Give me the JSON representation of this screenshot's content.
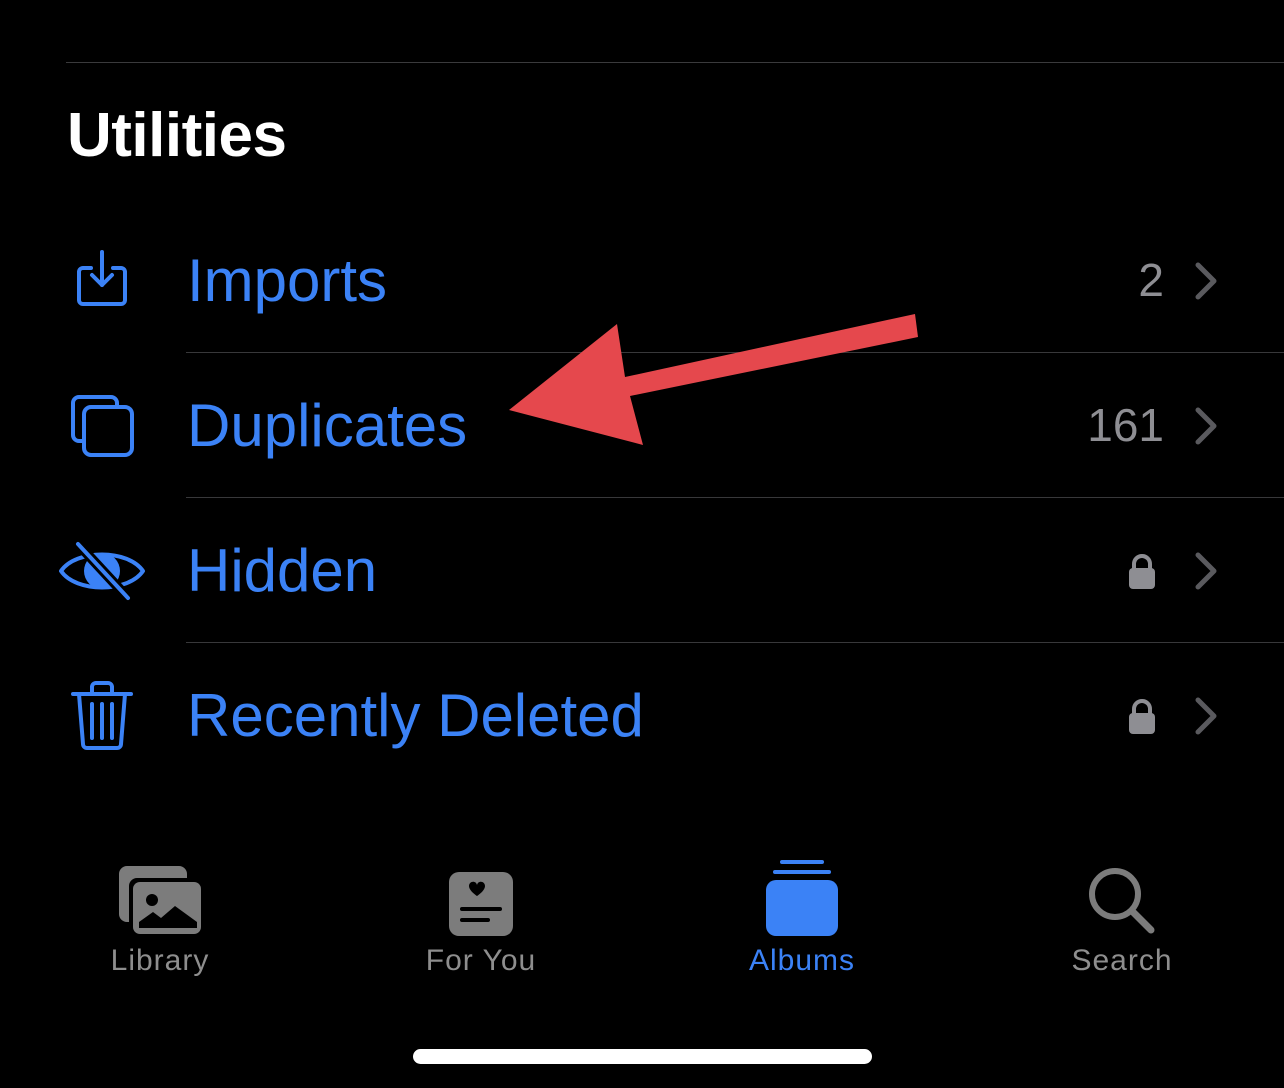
{
  "section": {
    "title": "Utilities"
  },
  "rows": [
    {
      "label": "Imports",
      "value": "2",
      "locked": false,
      "icon": "import-tray-icon"
    },
    {
      "label": "Duplicates",
      "value": "161",
      "locked": false,
      "icon": "duplicate-squares-icon"
    },
    {
      "label": "Hidden",
      "value": "",
      "locked": true,
      "icon": "eye-slash-icon"
    },
    {
      "label": "Recently Deleted",
      "value": "",
      "locked": true,
      "icon": "trash-icon"
    }
  ],
  "tabbar": {
    "tabs": [
      {
        "label": "Library",
        "icon": "photo-stack-icon",
        "active": false
      },
      {
        "label": "For You",
        "icon": "heart-card-icon",
        "active": false
      },
      {
        "label": "Albums",
        "icon": "albums-stack-icon",
        "active": true
      },
      {
        "label": "Search",
        "icon": "search-icon",
        "active": false
      }
    ]
  },
  "annotation": {
    "type": "arrow",
    "points_to": "Duplicates",
    "color": "#e5484d"
  },
  "colors": {
    "accent": "#3b82f6",
    "secondary_text": "#8e8e93",
    "background": "#000000"
  }
}
